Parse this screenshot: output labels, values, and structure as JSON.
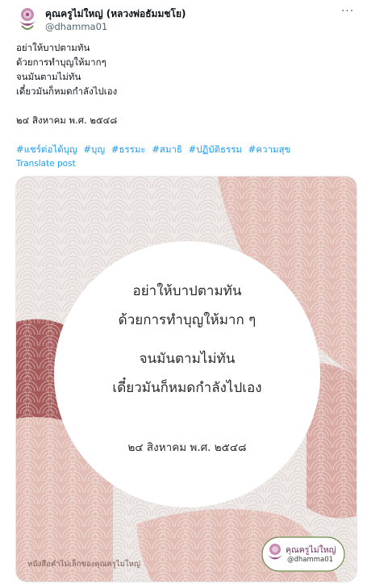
{
  "author": {
    "name": "คุณครูไม่ใหญ่ (หลวงพ่อธัมมชโย)",
    "handle": "@dhamma01"
  },
  "more_label": "···",
  "post": {
    "lines": [
      "อย่าให้บาปตามทัน",
      "ด้วยการทำบุญให้มากๆ",
      "จนมันตามไม่ทัน",
      "เดี๋ยวมันก็หมดกำลังไปเอง",
      "",
      "๒๔ สิงหาคม พ.ศ. ๒๕๔๘"
    ],
    "hashtags": [
      "#แชร์ต่อได้บุญ",
      "#บุญ",
      "#ธรรมะ",
      "#สมาธิ",
      "#ปฏิบัติธรรม",
      "#ความสุข"
    ],
    "translate_label": "Translate post"
  },
  "image": {
    "quote_lines": [
      "อย่าให้บาปตามทัน",
      "ด้วยการทำบุญให้มาก ๆ",
      "จนมันตามไม่ทัน",
      "เดี๋ยวมันก็หมดกำลังไปเอง"
    ],
    "date": "๒๔ สิงหาคม พ.ศ. ๒๕๔๘",
    "footer_text": "หนังสือคำไม่เล็กของคุณครูไม่ใหญ่",
    "logo_title": "คุณครูไม่ใหญ่",
    "logo_handle": "@dhamma01"
  },
  "colors": {
    "link": "#1d9bf0",
    "text": "#0f1419",
    "muted": "#536471",
    "card_bg": "#efeae7",
    "pink_light": "#e2bdb6",
    "pink_mid": "#d29e97",
    "maroon": "#a65a59"
  },
  "icons": {
    "avatar": "lotus-monk-avatar",
    "more": "more-horizontal-icon",
    "logo": "lotus-logo-icon"
  }
}
